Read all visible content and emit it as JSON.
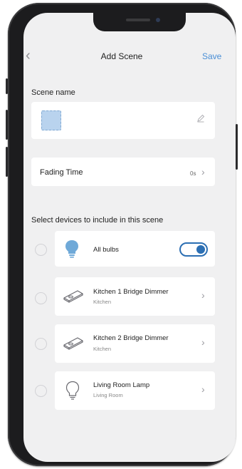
{
  "header": {
    "back_icon": "chevron-left-icon",
    "back_glyph": "‹",
    "title": "Add Scene",
    "save_label": "Save"
  },
  "scene_name": {
    "label": "Scene name",
    "edit_icon": "pencil-icon"
  },
  "fading_time": {
    "label": "Fading Time",
    "value": "0s",
    "chevron": "›"
  },
  "devices": {
    "label": "Select devices to include in this scene",
    "items": [
      {
        "name": "All bulbs",
        "room": "",
        "icon": "bulb-filled-icon",
        "toggle_on": true
      },
      {
        "name": "Kitchen 1 Bridge Dimmer",
        "room": "Kitchen",
        "icon": "dimmer-icon",
        "chevron": "›"
      },
      {
        "name": "Kitchen 2 Bridge Dimmer",
        "room": "Kitchen",
        "icon": "dimmer-icon",
        "chevron": "›"
      },
      {
        "name": "Living Room Lamp",
        "room": "Living Room",
        "icon": "bulb-outline-icon",
        "chevron": "›"
      }
    ]
  },
  "colors": {
    "accent": "#4a8fd6",
    "toggle": "#2c6fb3",
    "bulb": "#6fa9d8",
    "background": "#f0f0f1"
  }
}
